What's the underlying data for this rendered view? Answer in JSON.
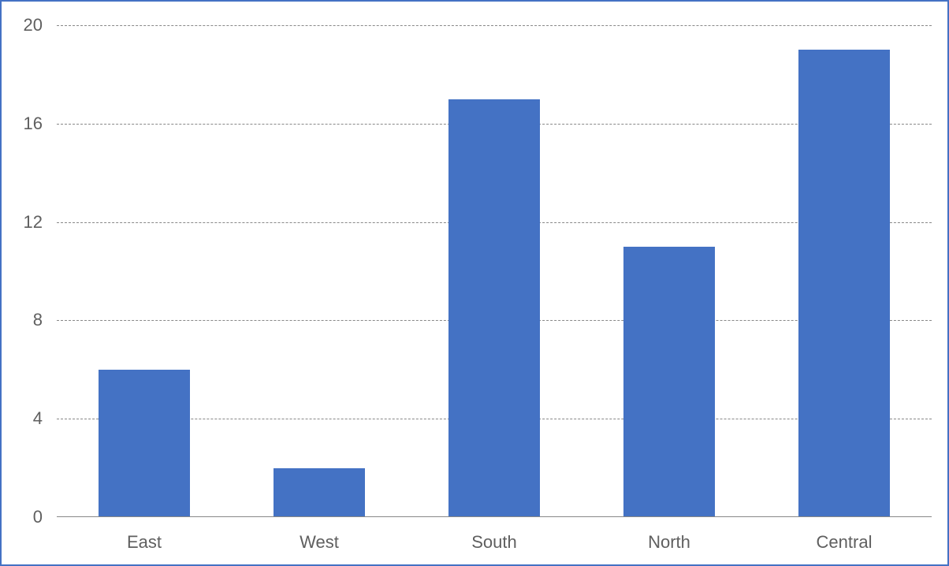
{
  "chart_data": {
    "type": "bar",
    "categories": [
      "East",
      "West",
      "South",
      "North",
      "Central"
    ],
    "values": [
      6,
      2,
      17,
      11,
      19
    ],
    "title": "",
    "xlabel": "",
    "ylabel": "",
    "ylim": [
      0,
      20
    ],
    "yticks": [
      0,
      4,
      8,
      12,
      16,
      20
    ],
    "bar_color": "#4472c4",
    "gridline_color": "#888888",
    "border_color": "#4472c4"
  }
}
